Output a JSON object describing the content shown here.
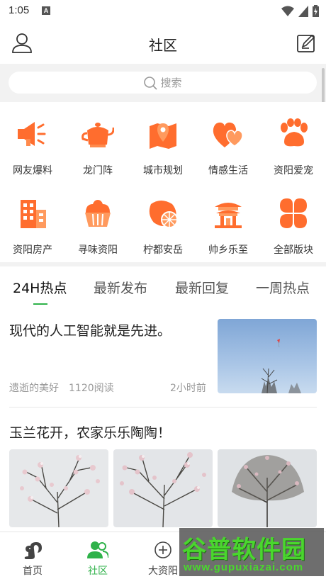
{
  "status_bar": {
    "time": "1:05",
    "a_badge": "A"
  },
  "header": {
    "title": "社区"
  },
  "search": {
    "placeholder": "搜索"
  },
  "categories": [
    {
      "label": "网友爆料",
      "icon": "megaphone-icon"
    },
    {
      "label": "龙门阵",
      "icon": "teapot-icon"
    },
    {
      "label": "城市规划",
      "icon": "map-pin-icon"
    },
    {
      "label": "情感生活",
      "icon": "hearts-icon"
    },
    {
      "label": "资阳爱宠",
      "icon": "paw-icon"
    },
    {
      "label": "资阳房产",
      "icon": "building-icon"
    },
    {
      "label": "寻味资阳",
      "icon": "cupcake-icon"
    },
    {
      "label": "柠都安岳",
      "icon": "lemon-icon"
    },
    {
      "label": "帅乡乐至",
      "icon": "pavilion-icon"
    },
    {
      "label": "全部版块",
      "icon": "clover-grid-icon"
    }
  ],
  "tabs": [
    {
      "label": "24H热点",
      "active": true
    },
    {
      "label": "最新发布",
      "active": false
    },
    {
      "label": "最新回复",
      "active": false
    },
    {
      "label": "一周热点",
      "active": false
    }
  ],
  "posts": [
    {
      "title": "现代的人工智能就是先进。",
      "author": "遗逝的美好",
      "reads": "1120阅读",
      "time": "2小时前"
    },
    {
      "title": "玉兰花开，农家乐乐陶陶！"
    }
  ],
  "bottom_nav": [
    {
      "label": "首页",
      "active": false
    },
    {
      "label": "社区",
      "active": true
    },
    {
      "label": "大资阳",
      "active": false
    }
  ],
  "watermark": {
    "logo_text": "谷普软件园",
    "url": "www.gupuxiazai.com"
  },
  "colors": {
    "accent_orange": "#ff6d2e",
    "accent_green": "#2fb24a"
  }
}
